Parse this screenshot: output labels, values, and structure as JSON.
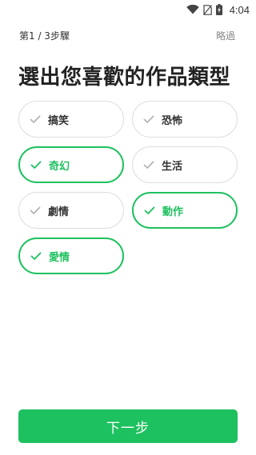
{
  "status_bar": {
    "time": "4:04",
    "icons": [
      "wifi-icon",
      "no-sim-icon",
      "battery-charging-icon"
    ]
  },
  "header": {
    "step": "第1 / 3步驟",
    "skip": "略過"
  },
  "title": "選出您喜歡的作品類型",
  "genres": [
    {
      "label": "搞笑",
      "selected": false
    },
    {
      "label": "恐怖",
      "selected": false
    },
    {
      "label": "奇幻",
      "selected": true
    },
    {
      "label": "生活",
      "selected": false
    },
    {
      "label": "劇情",
      "selected": false
    },
    {
      "label": "動作",
      "selected": true
    },
    {
      "label": "愛情",
      "selected": true
    }
  ],
  "next_button": {
    "label": "下一步"
  },
  "colors": {
    "accent": "#1ec15f",
    "chip_border": "#dedede",
    "check_inactive": "#b4b4b4",
    "text": "#222222"
  }
}
